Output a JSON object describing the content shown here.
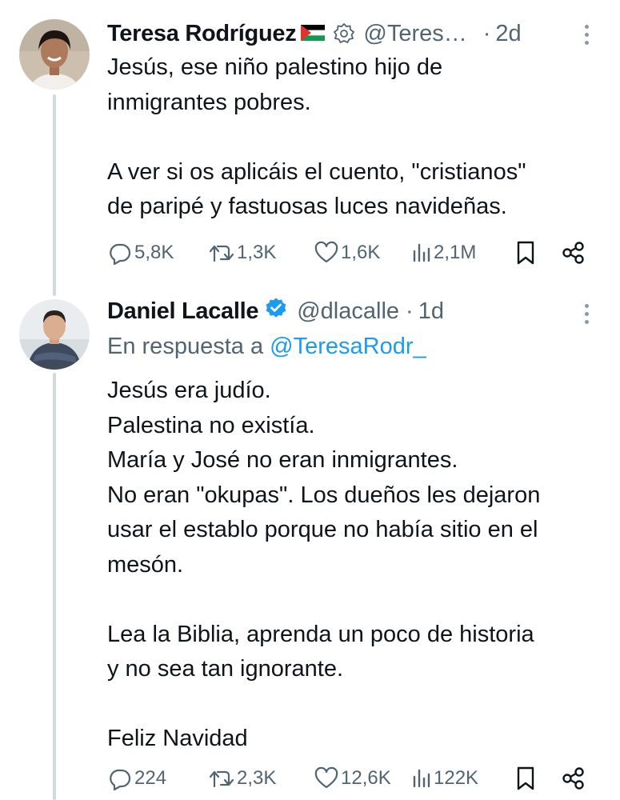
{
  "tweets": [
    {
      "author": {
        "name": "Teresa Rodríguez",
        "handle": "@Teres…",
        "flag_icon": "palestine-flag-icon",
        "badge_icon": "gear-badge-icon"
      },
      "time_sep": "·",
      "time": "2d",
      "body": [
        "Jesús, ese niño palestino hijo de",
        "inmigrantes pobres.",
        "",
        "A ver si os aplicáis el cuento, \"cristianos\"",
        "de paripé y fastuosas luces navideñas."
      ],
      "stats": {
        "replies": "5,8K",
        "reposts": "1,3K",
        "likes": "1,6K",
        "views": "2,1M"
      }
    },
    {
      "author": {
        "name": "Daniel Lacalle",
        "handle": "@dlacalle",
        "verified_color": "#1d9bf0"
      },
      "time_sep": "·",
      "time": "1d",
      "reply_to": {
        "prefix": "En respuesta a",
        "mention": "@TeresaRodr_"
      },
      "body": [
        "Jesús era judío.",
        "Palestina no existía.",
        "María y José no eran inmigrantes.",
        "No eran \"okupas\". Los dueños les dejaron",
        "usar el establo porque no había sitio en el",
        "mesón.",
        "",
        "Lea la Biblia, aprenda un poco de historia",
        "y no sea tan ignorante.",
        "",
        "Feliz Navidad"
      ],
      "stats": {
        "replies": "224",
        "reposts": "2,3K",
        "likes": "12,6K",
        "views": "122K"
      }
    }
  ],
  "colors": {
    "text": "#0f1419",
    "muted": "#536471",
    "accent": "#1d9bf0",
    "thread": "#cfd9de"
  }
}
